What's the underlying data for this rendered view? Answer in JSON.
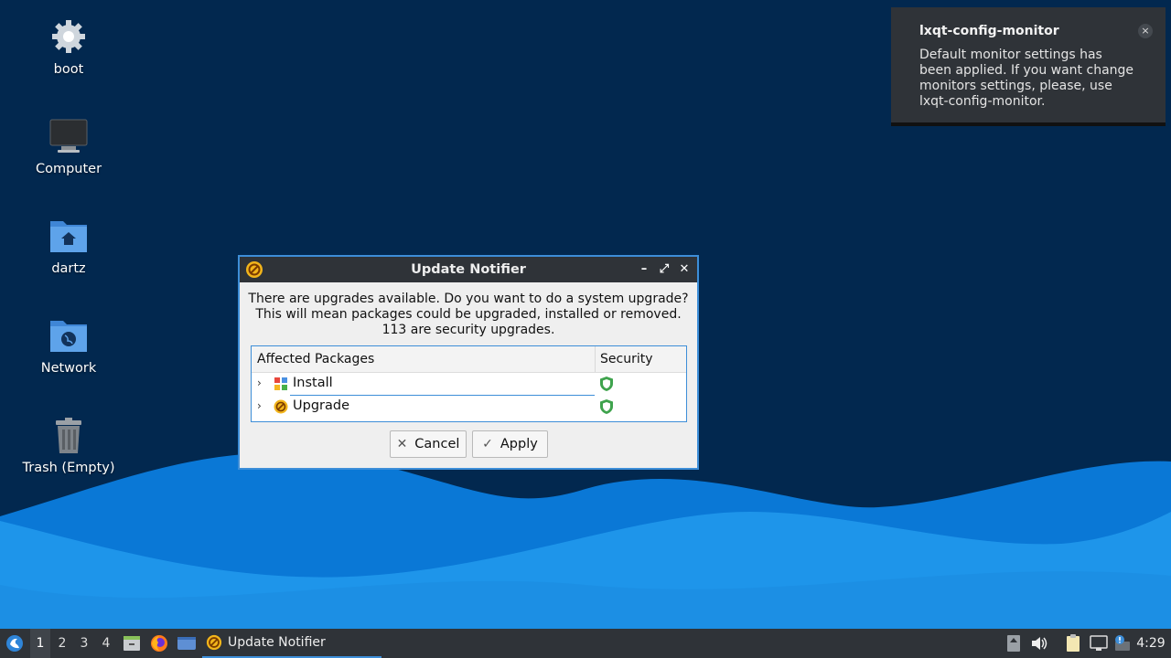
{
  "desktop": {
    "icons": [
      {
        "label": "boot",
        "icon": "gear-icon"
      },
      {
        "label": "Computer",
        "icon": "monitor-icon"
      },
      {
        "label": "dartz",
        "icon": "home-folder-icon"
      },
      {
        "label": "Network",
        "icon": "network-folder-icon"
      },
      {
        "label": "Trash (Empty)",
        "icon": "trash-icon"
      }
    ]
  },
  "notification": {
    "title": "lxqt-config-monitor",
    "body": "Default monitor settings has been applied. If you want change monitors settings, please, use lxqt-config-monitor.",
    "close_glyph": "×"
  },
  "dialog": {
    "title": "Update Notifier",
    "message_line1": "There are upgrades available. Do you want to do a system upgrade?",
    "message_line2": "This will mean packages could be upgraded, installed or removed.",
    "message_line3": "113 are security upgrades.",
    "columns": {
      "packages": "Affected Packages",
      "security": "Security"
    },
    "rows": [
      {
        "label": "Install",
        "icon": "install-packages-icon",
        "security_icon": "shield-icon"
      },
      {
        "label": "Upgrade",
        "icon": "upgrade-icon",
        "security_icon": "shield-icon"
      }
    ],
    "cancel_label": "Cancel",
    "apply_label": "Apply"
  },
  "taskbar": {
    "workspaces": [
      "1",
      "2",
      "3",
      "4"
    ],
    "active_workspace": "1",
    "task_label": "Update Notifier",
    "clock": "4:29"
  },
  "colors": {
    "desktop_bg": "#02284f",
    "accent": "#3d8ed8",
    "panel_bg": "#2f3338",
    "security_green": "#3fa34d"
  }
}
